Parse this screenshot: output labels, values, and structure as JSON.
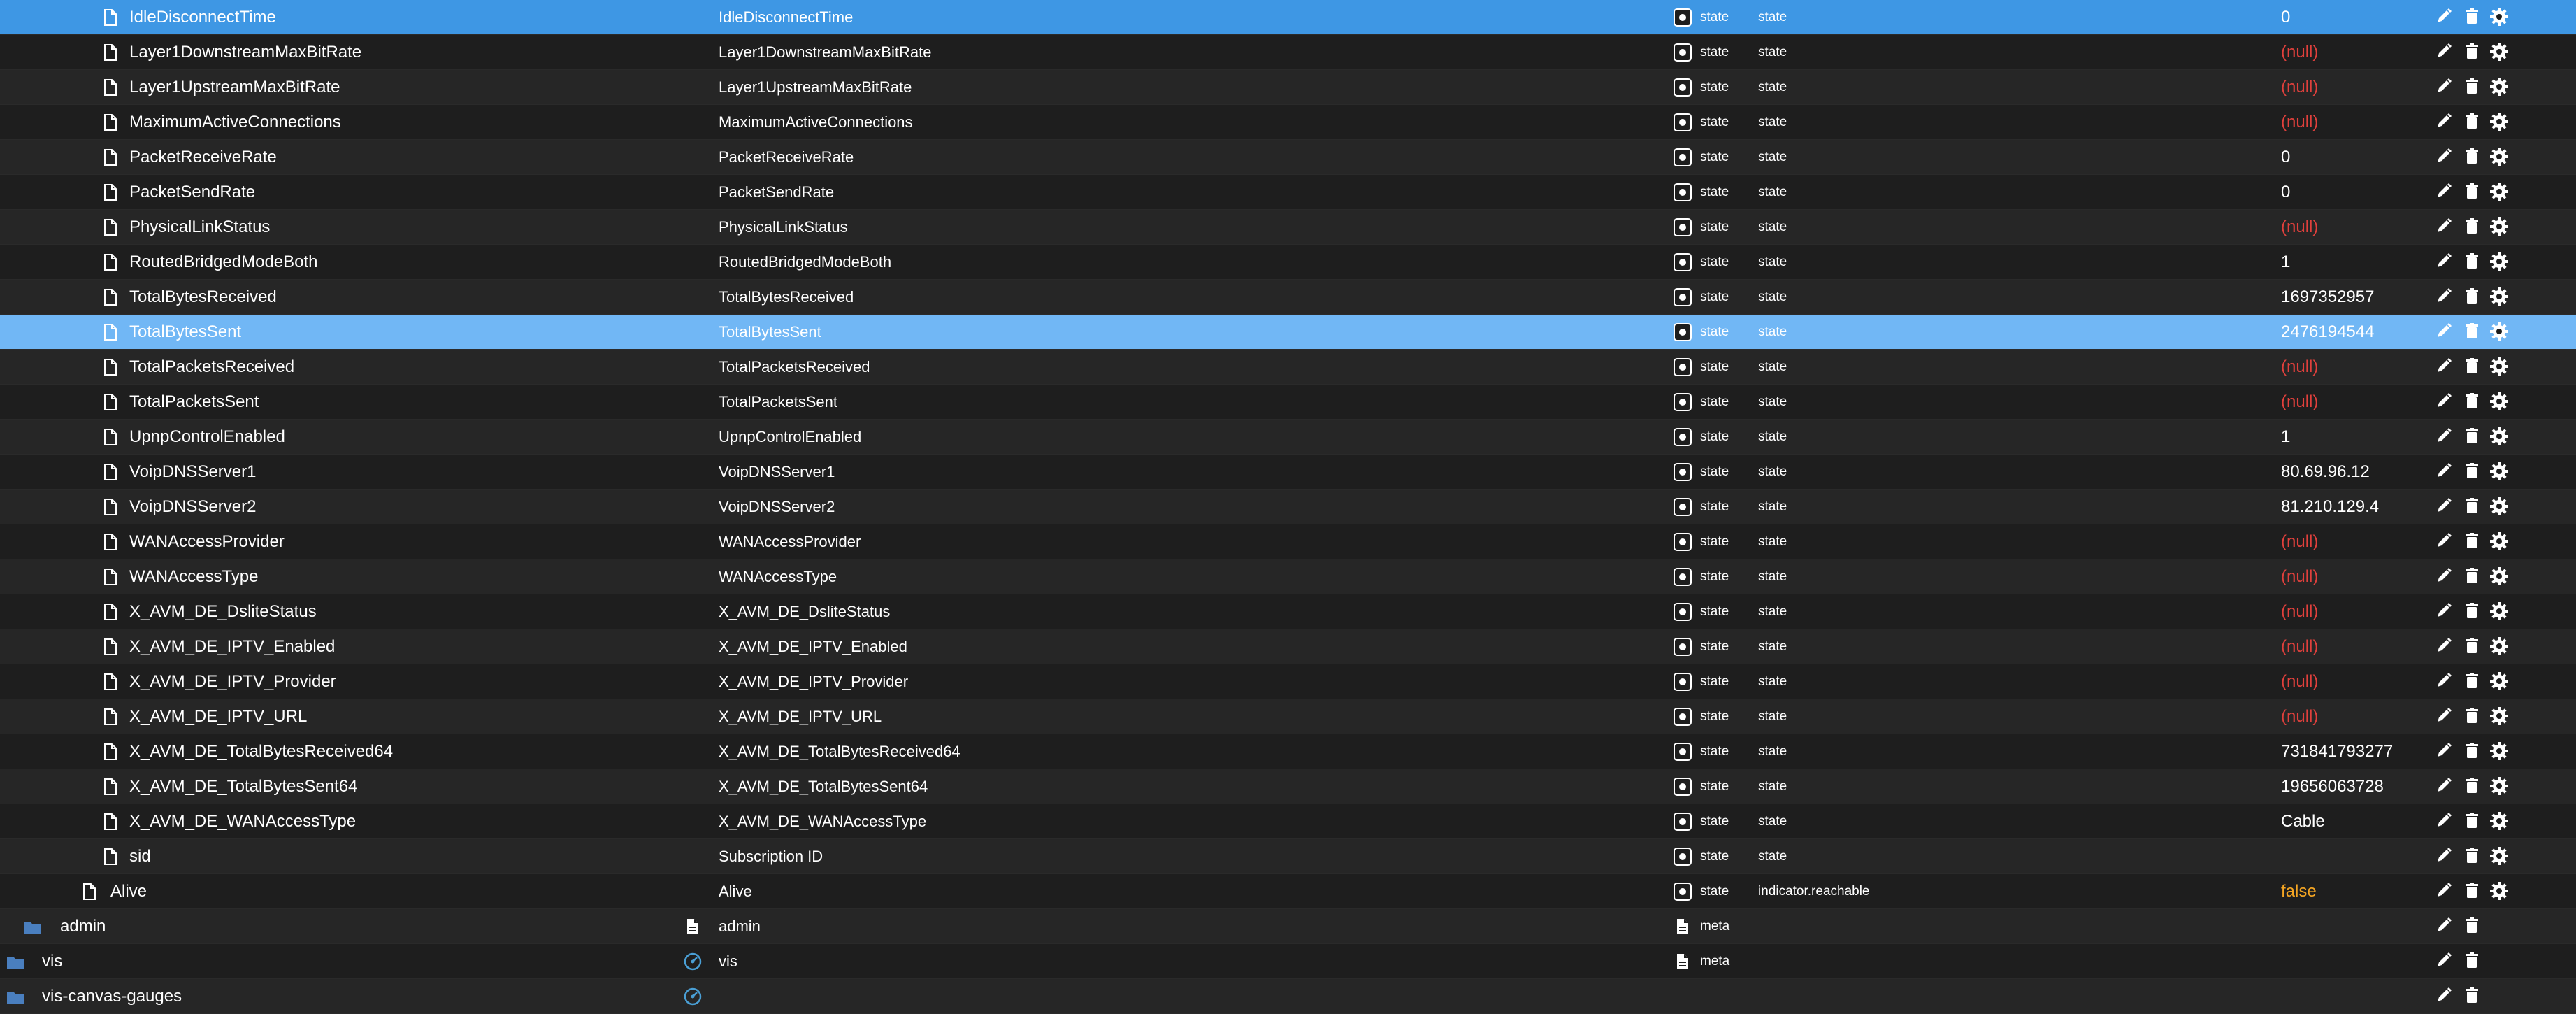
{
  "rows": [
    {
      "name": "IdleDisconnectTime",
      "id": "IdleDisconnectTime",
      "type": "state",
      "role": "state",
      "value": "0",
      "value_kind": "normal",
      "selected": "primary",
      "indent": "child"
    },
    {
      "name": "Layer1DownstreamMaxBitRate",
      "id": "Layer1DownstreamMaxBitRate",
      "type": "state",
      "role": "state",
      "value": "(null)",
      "value_kind": "null",
      "indent": "child"
    },
    {
      "name": "Layer1UpstreamMaxBitRate",
      "id": "Layer1UpstreamMaxBitRate",
      "type": "state",
      "role": "state",
      "value": "(null)",
      "value_kind": "null",
      "indent": "child"
    },
    {
      "name": "MaximumActiveConnections",
      "id": "MaximumActiveConnections",
      "type": "state",
      "role": "state",
      "value": "(null)",
      "value_kind": "null",
      "indent": "child"
    },
    {
      "name": "PacketReceiveRate",
      "id": "PacketReceiveRate",
      "type": "state",
      "role": "state",
      "value": "0",
      "value_kind": "normal",
      "indent": "child"
    },
    {
      "name": "PacketSendRate",
      "id": "PacketSendRate",
      "type": "state",
      "role": "state",
      "value": "0",
      "value_kind": "normal",
      "indent": "child"
    },
    {
      "name": "PhysicalLinkStatus",
      "id": "PhysicalLinkStatus",
      "type": "state",
      "role": "state",
      "value": "(null)",
      "value_kind": "null",
      "indent": "child"
    },
    {
      "name": "RoutedBridgedModeBoth",
      "id": "RoutedBridgedModeBoth",
      "type": "state",
      "role": "state",
      "value": "1",
      "value_kind": "normal",
      "indent": "child"
    },
    {
      "name": "TotalBytesReceived",
      "id": "TotalBytesReceived",
      "type": "state",
      "role": "state",
      "value": "1697352957",
      "value_kind": "normal",
      "indent": "child"
    },
    {
      "name": "TotalBytesSent",
      "id": "TotalBytesSent",
      "type": "state",
      "role": "state",
      "value": "2476194544",
      "value_kind": "normal",
      "selected": "hover",
      "indent": "child"
    },
    {
      "name": "TotalPacketsReceived",
      "id": "TotalPacketsReceived",
      "type": "state",
      "role": "state",
      "value": "(null)",
      "value_kind": "null",
      "indent": "child"
    },
    {
      "name": "TotalPacketsSent",
      "id": "TotalPacketsSent",
      "type": "state",
      "role": "state",
      "value": "(null)",
      "value_kind": "null",
      "indent": "child"
    },
    {
      "name": "UpnpControlEnabled",
      "id": "UpnpControlEnabled",
      "type": "state",
      "role": "state",
      "value": "1",
      "value_kind": "normal",
      "indent": "child"
    },
    {
      "name": "VoipDNSServer1",
      "id": "VoipDNSServer1",
      "type": "state",
      "role": "state",
      "value": "80.69.96.12",
      "value_kind": "normal",
      "indent": "child"
    },
    {
      "name": "VoipDNSServer2",
      "id": "VoipDNSServer2",
      "type": "state",
      "role": "state",
      "value": "81.210.129.4",
      "value_kind": "normal",
      "indent": "child"
    },
    {
      "name": "WANAccessProvider",
      "id": "WANAccessProvider",
      "type": "state",
      "role": "state",
      "value": "(null)",
      "value_kind": "null",
      "indent": "child"
    },
    {
      "name": "WANAccessType",
      "id": "WANAccessType",
      "type": "state",
      "role": "state",
      "value": "(null)",
      "value_kind": "null",
      "indent": "child"
    },
    {
      "name": "X_AVM_DE_DsliteStatus",
      "id": "X_AVM_DE_DsliteStatus",
      "type": "state",
      "role": "state",
      "value": "(null)",
      "value_kind": "null",
      "indent": "child"
    },
    {
      "name": "X_AVM_DE_IPTV_Enabled",
      "id": "X_AVM_DE_IPTV_Enabled",
      "type": "state",
      "role": "state",
      "value": "(null)",
      "value_kind": "null",
      "indent": "child"
    },
    {
      "name": "X_AVM_DE_IPTV_Provider",
      "id": "X_AVM_DE_IPTV_Provider",
      "type": "state",
      "role": "state",
      "value": "(null)",
      "value_kind": "null",
      "indent": "child"
    },
    {
      "name": "X_AVM_DE_IPTV_URL",
      "id": "X_AVM_DE_IPTV_URL",
      "type": "state",
      "role": "state",
      "value": "(null)",
      "value_kind": "null",
      "indent": "child"
    },
    {
      "name": "X_AVM_DE_TotalBytesReceived64",
      "id": "X_AVM_DE_TotalBytesReceived64",
      "type": "state",
      "role": "state",
      "value": "731841793277",
      "value_kind": "normal",
      "indent": "child"
    },
    {
      "name": "X_AVM_DE_TotalBytesSent64",
      "id": "X_AVM_DE_TotalBytesSent64",
      "type": "state",
      "role": "state",
      "value": "19656063728",
      "value_kind": "normal",
      "indent": "child"
    },
    {
      "name": "X_AVM_DE_WANAccessType",
      "id": "X_AVM_DE_WANAccessType",
      "type": "state",
      "role": "state",
      "value": "Cable",
      "value_kind": "normal",
      "indent": "child"
    },
    {
      "name": "sid",
      "id": "Subscription ID",
      "type": "state",
      "role": "state",
      "value": "",
      "value_kind": "normal",
      "indent": "child"
    },
    {
      "name": "Alive",
      "id": "Alive",
      "type": "state",
      "role": "indicator.reachable",
      "value": "false",
      "value_kind": "false",
      "indent": "parent"
    },
    {
      "name": "admin",
      "id": "admin",
      "type": "meta",
      "role": "",
      "value": "",
      "value_kind": "normal",
      "indent": "folder1",
      "kind": "folder",
      "id_icon": "document"
    },
    {
      "name": "vis",
      "id": "vis",
      "type": "meta",
      "role": "",
      "value": "",
      "value_kind": "normal",
      "indent": "folder0",
      "kind": "folder",
      "id_icon": "gauge"
    },
    {
      "name": "vis-canvas-gauges",
      "id": "",
      "type": "",
      "role": "",
      "value": "",
      "value_kind": "normal",
      "indent": "folder0",
      "kind": "folder",
      "id_icon": "gauge"
    }
  ]
}
